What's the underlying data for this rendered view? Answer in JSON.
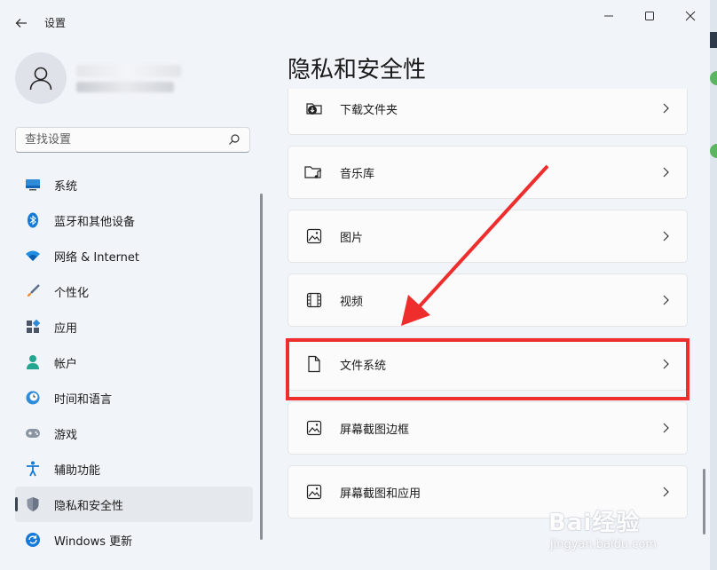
{
  "window": {
    "title": "设置"
  },
  "search": {
    "placeholder": "查找设置"
  },
  "sidebar": {
    "items": [
      {
        "label": "系统",
        "icon": "monitor-icon"
      },
      {
        "label": "蓝牙和其他设备",
        "icon": "bluetooth-icon"
      },
      {
        "label": "网络 & Internet",
        "icon": "wifi-icon"
      },
      {
        "label": "个性化",
        "icon": "brush-icon"
      },
      {
        "label": "应用",
        "icon": "apps-icon"
      },
      {
        "label": "帐户",
        "icon": "account-icon"
      },
      {
        "label": "时间和语言",
        "icon": "clock-globe-icon"
      },
      {
        "label": "游戏",
        "icon": "gamepad-icon"
      },
      {
        "label": "辅助功能",
        "icon": "accessibility-icon"
      },
      {
        "label": "隐私和安全性",
        "icon": "shield-icon",
        "active": true
      },
      {
        "label": "Windows 更新",
        "icon": "update-icon"
      }
    ]
  },
  "main": {
    "title": "隐私和安全性",
    "items": [
      {
        "label": "下载文件夹",
        "icon": "download-folder-icon"
      },
      {
        "label": "音乐库",
        "icon": "music-folder-icon"
      },
      {
        "label": "图片",
        "icon": "picture-icon"
      },
      {
        "label": "视频",
        "icon": "film-icon"
      },
      {
        "label": "文件系统",
        "icon": "document-icon"
      },
      {
        "label": "屏幕截图边框",
        "icon": "picture-icon"
      },
      {
        "label": "屏幕截图和应用",
        "icon": "picture-icon"
      }
    ]
  },
  "watermark": {
    "logo": "Bai经验",
    "url": "jingyan.baidu.com"
  },
  "colors": {
    "annotation": "#ee2d2d",
    "accent": "#0067c0"
  }
}
